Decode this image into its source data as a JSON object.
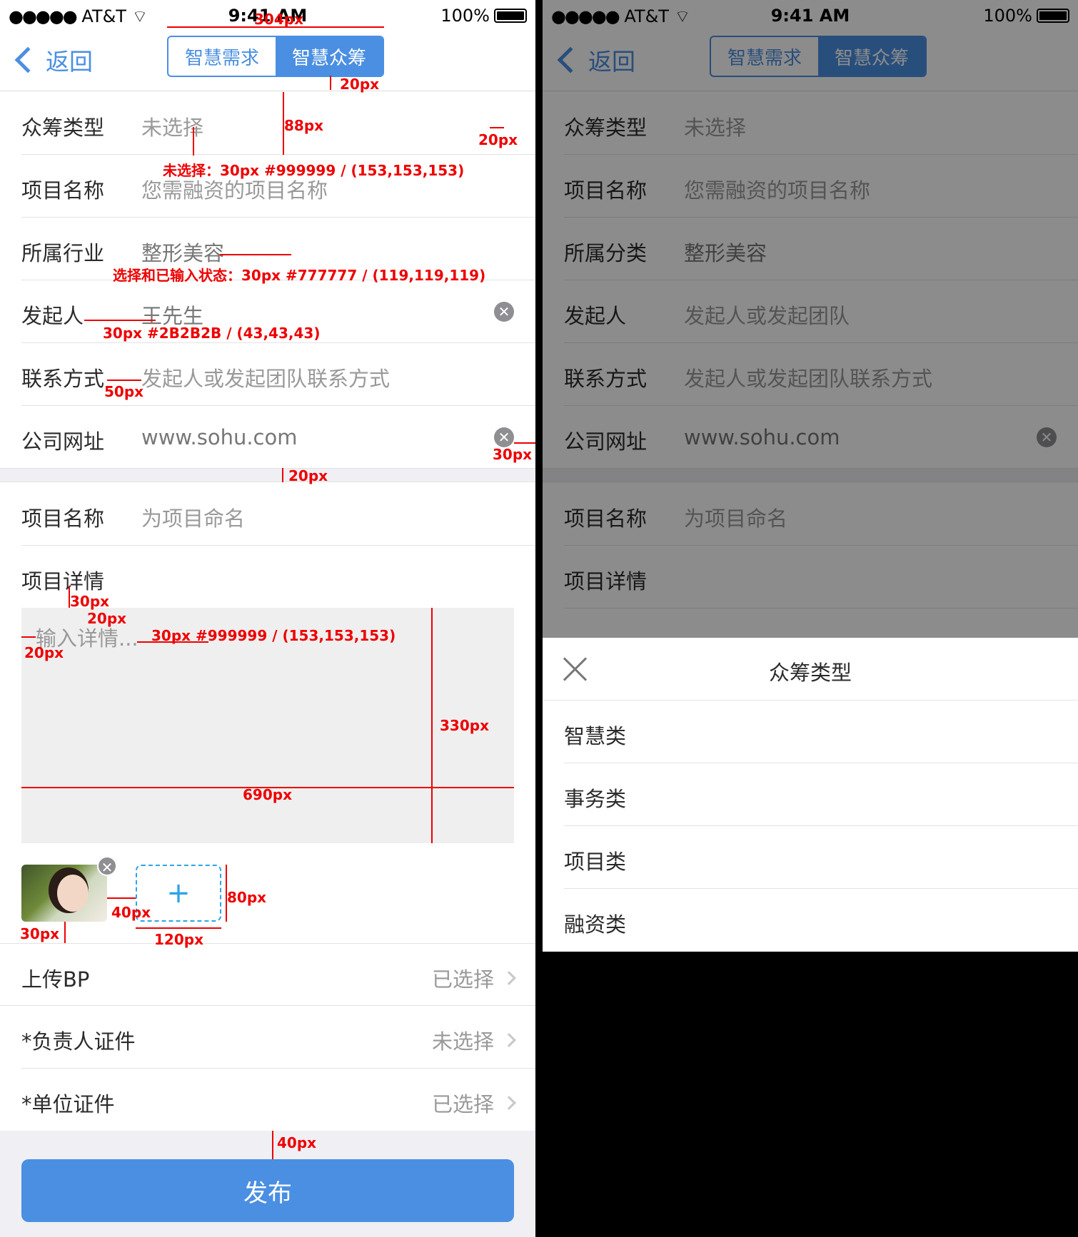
{
  "status": {
    "signal": "●●●●●",
    "carrier": "AT&T",
    "time": "9:41 AM",
    "battery": "100%"
  },
  "nav": {
    "back": "返回",
    "tab_left": "智慧需求",
    "tab_right": "智慧众筹"
  },
  "form": {
    "r1": {
      "label": "众筹类型",
      "value": "未选择"
    },
    "r2": {
      "label": "项目名称",
      "value": "您需融资的项目名称"
    },
    "r3": {
      "label": "所属行业",
      "value": "整形美容"
    },
    "r4": {
      "label": "发起人",
      "value": "王先生"
    },
    "r5": {
      "label": "联系方式",
      "value": "发起人或发起团队联系方式"
    },
    "r6": {
      "label": "公司网址",
      "value": "www.sohu.com"
    },
    "r7": {
      "label": "项目名称",
      "value": "为项目命名"
    },
    "r8": {
      "label": "项目详情"
    },
    "detail_placeholder": "输入详情...",
    "add_symbol": "+",
    "clear_symbol": "✕",
    "r9": {
      "label": "上传BP",
      "value": "已选择"
    },
    "r10": {
      "label": "*负责人证件",
      "value": "未选择"
    },
    "r11": {
      "label": "*单位证件",
      "value": "已选择"
    },
    "publish": "发布"
  },
  "annotations": {
    "a1": "304px",
    "a2": "20px",
    "a3": "88px",
    "a4": "20px",
    "a5": "未选择：30px #999999 / (153,153,153)",
    "a6": "选择和已输入状态：30px #777777 / (119,119,119)",
    "a7": "30px #2B2B2B / (43,43,43)",
    "a8": "50px",
    "a9": "30px",
    "a10": "20px",
    "a11": "30px",
    "a12": "20px",
    "a13": "20px",
    "a14": "30px #999999 / (153,153,153)",
    "a15": "330px",
    "a16": "690px",
    "a17": "40px",
    "a18": "80px",
    "a19": "30px",
    "a20": "120px",
    "a21": "40px"
  },
  "right": {
    "r1": {
      "label": "众筹类型",
      "value": "未选择"
    },
    "r2": {
      "label": "项目名称",
      "value": "您需融资的项目名称"
    },
    "r3": {
      "label": "所属分类",
      "value": "整形美容"
    },
    "r4": {
      "label": "发起人",
      "value": "发起人或发起团队"
    },
    "r5": {
      "label": "联系方式",
      "value": "发起人或发起团队联系方式"
    },
    "r6": {
      "label": "公司网址",
      "value": "www.sohu.com"
    },
    "r7": {
      "label": "项目名称",
      "value": "为项目命名"
    },
    "r8": {
      "label": "项目详情"
    },
    "sheet_title": "众筹类型",
    "options": [
      "智慧类",
      "事务类",
      "项目类",
      "融资类"
    ]
  },
  "colors": {
    "accent": "#4a8fe2",
    "placeholder": "#999999",
    "filled": "#777777",
    "label": "#2b2b2b",
    "annotation": "#ee0000"
  }
}
